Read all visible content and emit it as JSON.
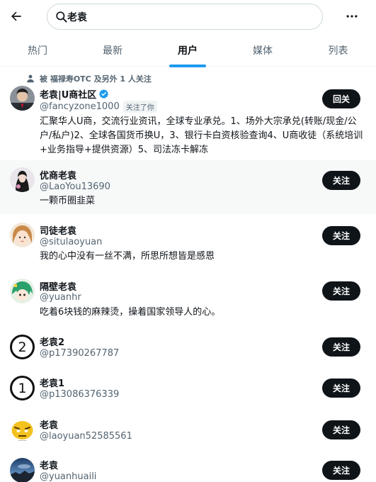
{
  "search": {
    "query": "老袁"
  },
  "icons": {
    "back": "arrow-left-icon",
    "search": "search-icon",
    "more": "more-horizontal-icon",
    "person": "person-icon",
    "verified": "verified-badge-icon"
  },
  "colors": {
    "accent": "#1d9bf0",
    "text": "#0f1419",
    "muted": "#536471"
  },
  "tabs": [
    {
      "label": "热门"
    },
    {
      "label": "最新"
    },
    {
      "label": "用户",
      "active": true
    },
    {
      "label": "媒体"
    },
    {
      "label": "列表"
    }
  ],
  "users": [
    {
      "context": "被 福禄寿OTC 及另外 1 人关注",
      "name": "老袁|U商社区",
      "handle": "@fancyzone1000",
      "follows_you": "关注了你",
      "bio": "汇聚华人U商，交流行业资讯，全球专业承兑。1、场外大宗承兑(转账/现金/公户/私户)2、全球各国货币换U，3、银行卡白资核验查询4、U商收徒（系统培训+业务指导+提供资源）5、司法冻卡解冻",
      "button": "回关",
      "verified": true
    },
    {
      "name": "优商老袁",
      "handle": "@LaoYou13690",
      "bio": "一颗币圈韭菜",
      "button": "关注"
    },
    {
      "name": "司徒老袁",
      "handle": "@situlaoyuan",
      "bio": "我的心中没有一丝不满，所思所想皆是感恩",
      "button": "关注"
    },
    {
      "name": "隔壁老袁",
      "handle": "@yuanhr",
      "bio": "吃着6块钱的麻辣烫，操着国家领导人的心。",
      "button": "关注"
    },
    {
      "name": "老袁2",
      "handle": "@p17390267787",
      "button": "关注",
      "avatar_text": "2"
    },
    {
      "name": "老袁1",
      "handle": "@p13086376339",
      "button": "关注",
      "avatar_text": "1"
    },
    {
      "name": "老袁",
      "handle": "@laoyuan52585561",
      "button": "关注"
    },
    {
      "name": "老袁",
      "handle": "@yuanhuaili",
      "button": "关注"
    }
  ]
}
